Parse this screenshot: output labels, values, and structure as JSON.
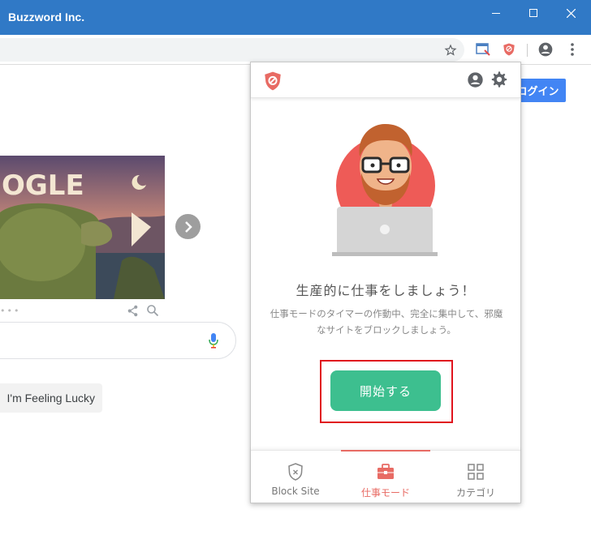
{
  "window": {
    "title": "Buzzword Inc.",
    "minimize_icon": "minimize-icon",
    "maximize_icon": "maximize-icon",
    "close_icon": "close-icon"
  },
  "toolbar": {
    "icons": [
      "star-icon",
      "extension-icon",
      "block-site-extension-icon",
      "account-icon",
      "menu-icon"
    ]
  },
  "google": {
    "login_label": "ログイン",
    "lucky_label": "I'm Feeling Lucky",
    "doodle_text": "OGLE"
  },
  "popup": {
    "heading": "生産的に仕事をしましょう！",
    "description": "仕事モードのタイマーの作動中、完全に集中して、邪魔なサイトをブロックしましょう。",
    "start_label": "開始する",
    "tabs": [
      {
        "label": "Block Site",
        "icon": "shield-x-icon",
        "active": false
      },
      {
        "label": "仕事モード",
        "icon": "briefcase-icon",
        "active": true
      },
      {
        "label": "カテゴリ",
        "icon": "grid-icon",
        "active": false
      }
    ],
    "colors": {
      "accent": "#e86b64",
      "start": "#3dbf8f",
      "highlight": "#e0141e"
    }
  }
}
